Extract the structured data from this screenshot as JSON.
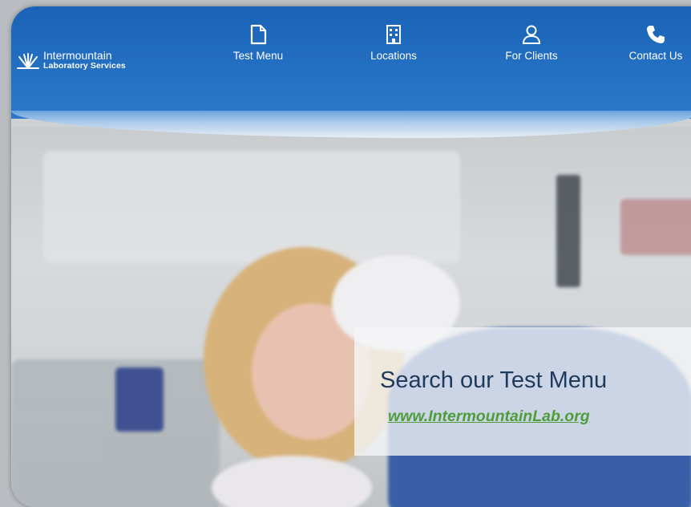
{
  "logo": {
    "name": "Intermountain",
    "sub": "Laboratory Services"
  },
  "nav": {
    "items": [
      {
        "label": "Test Menu",
        "icon": "document-icon"
      },
      {
        "label": "Locations",
        "icon": "building-icon"
      },
      {
        "label": "For Clients",
        "icon": "user-icon"
      },
      {
        "label": "Contact Us",
        "icon": "phone-icon"
      }
    ]
  },
  "hero": {
    "title": "Search our Test Menu",
    "url": "www.IntermountainLab.org"
  },
  "colors": {
    "header_blue": "#1a63b7",
    "link_green": "#4f9d3a",
    "title_navy": "#1f3a5c"
  }
}
